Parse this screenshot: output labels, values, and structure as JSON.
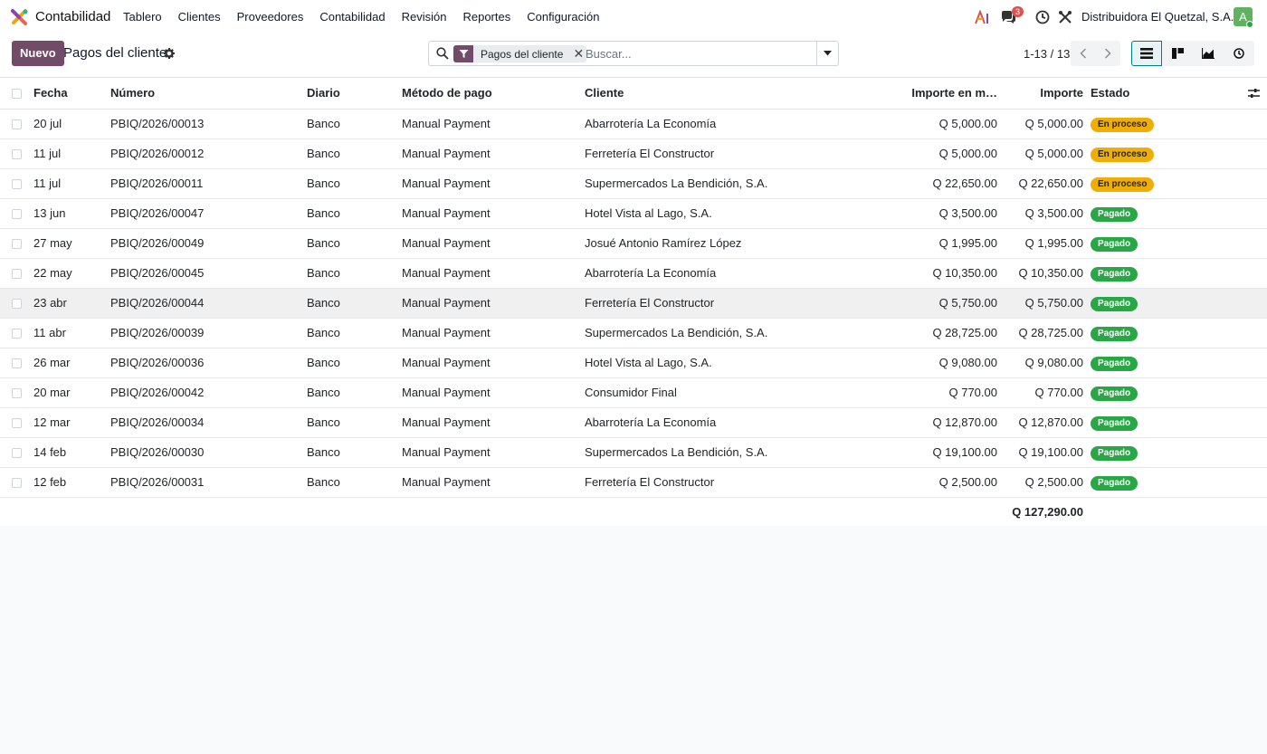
{
  "navbar": {
    "app_name": "Contabilidad",
    "menu": [
      "Tablero",
      "Clientes",
      "Proveedores",
      "Contabilidad",
      "Revisión",
      "Reportes",
      "Configuración"
    ],
    "messages_count": "3",
    "company": "Distribuidora El Quetzal, S.A.",
    "avatar_letter": "A"
  },
  "control": {
    "new_button": "Nuevo",
    "title": "Pagos del cliente",
    "facet_label": "Pagos del cliente",
    "search_placeholder": "Buscar...",
    "pager": "1-13 / 13"
  },
  "table": {
    "columns": [
      "Fecha",
      "Número",
      "Diario",
      "Método de pago",
      "Cliente",
      "Importe en m…",
      "Importe",
      "Estado"
    ],
    "rows": [
      {
        "fecha": "20 jul",
        "numero": "PBIQ/2026/00013",
        "diario": "Banco",
        "metodo": "Manual Payment",
        "cliente": "Abarrotería La Economía",
        "importe_moneda": "Q 5,000.00",
        "importe": "Q 5,000.00",
        "estado": "En proceso"
      },
      {
        "fecha": "11 jul",
        "numero": "PBIQ/2026/00012",
        "diario": "Banco",
        "metodo": "Manual Payment",
        "cliente": "Ferretería El Constructor",
        "importe_moneda": "Q 5,000.00",
        "importe": "Q 5,000.00",
        "estado": "En proceso"
      },
      {
        "fecha": "11 jul",
        "numero": "PBIQ/2026/00011",
        "diario": "Banco",
        "metodo": "Manual Payment",
        "cliente": "Supermercados La Bendición, S.A.",
        "importe_moneda": "Q 22,650.00",
        "importe": "Q 22,650.00",
        "estado": "En proceso"
      },
      {
        "fecha": "13 jun",
        "numero": "PBIQ/2026/00047",
        "diario": "Banco",
        "metodo": "Manual Payment",
        "cliente": "Hotel Vista al Lago, S.A.",
        "importe_moneda": "Q 3,500.00",
        "importe": "Q 3,500.00",
        "estado": "Pagado"
      },
      {
        "fecha": "27 may",
        "numero": "PBIQ/2026/00049",
        "diario": "Banco",
        "metodo": "Manual Payment",
        "cliente": "Josué Antonio Ramírez López",
        "importe_moneda": "Q 1,995.00",
        "importe": "Q 1,995.00",
        "estado": "Pagado"
      },
      {
        "fecha": "22 may",
        "numero": "PBIQ/2026/00045",
        "diario": "Banco",
        "metodo": "Manual Payment",
        "cliente": "Abarrotería La Economía",
        "importe_moneda": "Q 10,350.00",
        "importe": "Q 10,350.00",
        "estado": "Pagado"
      },
      {
        "fecha": "23 abr",
        "numero": "PBIQ/2026/00044",
        "diario": "Banco",
        "metodo": "Manual Payment",
        "cliente": "Ferretería El Constructor",
        "importe_moneda": "Q 5,750.00",
        "importe": "Q 5,750.00",
        "estado": "Pagado"
      },
      {
        "fecha": "11 abr",
        "numero": "PBIQ/2026/00039",
        "diario": "Banco",
        "metodo": "Manual Payment",
        "cliente": "Supermercados La Bendición, S.A.",
        "importe_moneda": "Q 28,725.00",
        "importe": "Q 28,725.00",
        "estado": "Pagado"
      },
      {
        "fecha": "26 mar",
        "numero": "PBIQ/2026/00036",
        "diario": "Banco",
        "metodo": "Manual Payment",
        "cliente": "Hotel Vista al Lago, S.A.",
        "importe_moneda": "Q 9,080.00",
        "importe": "Q 9,080.00",
        "estado": "Pagado"
      },
      {
        "fecha": "20 mar",
        "numero": "PBIQ/2026/00042",
        "diario": "Banco",
        "metodo": "Manual Payment",
        "cliente": "Consumidor Final",
        "importe_moneda": "Q 770.00",
        "importe": "Q 770.00",
        "estado": "Pagado"
      },
      {
        "fecha": "12 mar",
        "numero": "PBIQ/2026/00034",
        "diario": "Banco",
        "metodo": "Manual Payment",
        "cliente": "Abarrotería La Economía",
        "importe_moneda": "Q 12,870.00",
        "importe": "Q 12,870.00",
        "estado": "Pagado"
      },
      {
        "fecha": "14 feb",
        "numero": "PBIQ/2026/00030",
        "diario": "Banco",
        "metodo": "Manual Payment",
        "cliente": "Supermercados La Bendición, S.A.",
        "importe_moneda": "Q 19,100.00",
        "importe": "Q 19,100.00",
        "estado": "Pagado"
      },
      {
        "fecha": "12 feb",
        "numero": "PBIQ/2026/00031",
        "diario": "Banco",
        "metodo": "Manual Payment",
        "cliente": "Ferretería El Constructor",
        "importe_moneda": "Q 2,500.00",
        "importe": "Q 2,500.00",
        "estado": "Pagado"
      }
    ],
    "total": "Q 127,290.00"
  },
  "colors": {
    "primary": "#714b67",
    "status_in_progress": "#f0ad05",
    "status_paid": "#28a745",
    "active_view": "#017e84"
  },
  "icons": [
    "app-logo-icon",
    "ai-icon",
    "messages-icon",
    "activity-clock-icon",
    "tools-icon",
    "gear-icon",
    "search-icon",
    "filter-icon",
    "close-icon",
    "caret-down-icon",
    "chevron-left-icon",
    "chevron-right-icon",
    "list-view-icon",
    "kanban-view-icon",
    "graph-view-icon",
    "activity-view-icon",
    "optional-columns-icon"
  ]
}
